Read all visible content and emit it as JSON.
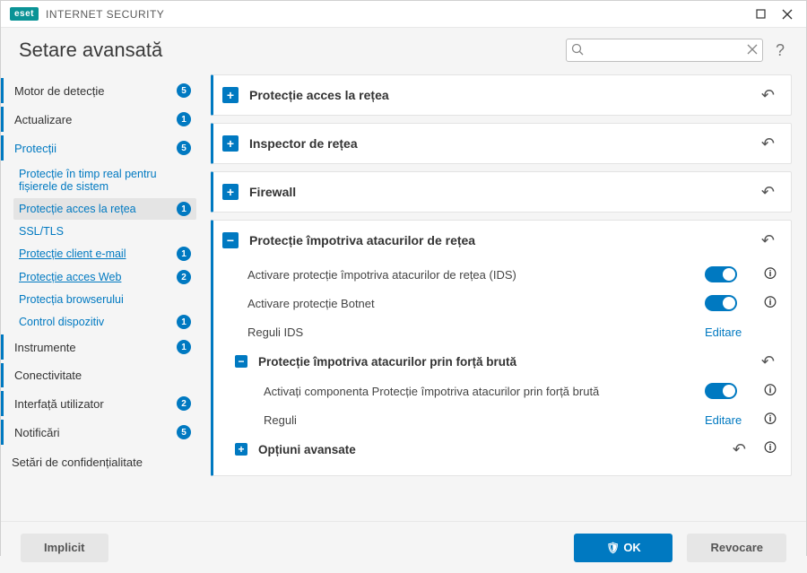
{
  "window": {
    "brand_badge": "eset",
    "brand_text": "INTERNET SECURITY"
  },
  "header": {
    "title": "Setare avansată",
    "search_placeholder": ""
  },
  "sidebar": {
    "items": [
      {
        "label": "Motor de detecție",
        "badge": "5",
        "kind": "top"
      },
      {
        "label": "Actualizare",
        "badge": "1",
        "kind": "top"
      },
      {
        "label": "Protecții",
        "badge": "5",
        "kind": "top",
        "accent": true
      },
      {
        "label": "Protecție în timp real pentru fișierele de sistem",
        "kind": "sub"
      },
      {
        "label": "Protecție acces la rețea",
        "badge": "1",
        "kind": "sub",
        "selected": true
      },
      {
        "label": "SSL/TLS",
        "kind": "sub"
      },
      {
        "label": "Protecție client e-mail",
        "badge": "1",
        "kind": "sub",
        "under": true
      },
      {
        "label": "Protecție acces Web",
        "badge": "2",
        "kind": "sub",
        "under": true
      },
      {
        "label": "Protecția browserului",
        "kind": "sub"
      },
      {
        "label": "Control dispozitiv",
        "badge": "1",
        "kind": "sub"
      },
      {
        "label": "Instrumente",
        "badge": "1",
        "kind": "top"
      },
      {
        "label": "Conectivitate",
        "kind": "top"
      },
      {
        "label": "Interfață utilizator",
        "badge": "2",
        "kind": "top"
      },
      {
        "label": "Notificări",
        "badge": "5",
        "kind": "top"
      },
      {
        "label": "Setări de confidențialitate",
        "kind": "plain"
      }
    ]
  },
  "panels": {
    "collapsed": [
      {
        "title": "Protecție acces la rețea"
      },
      {
        "title": "Inspector de rețea"
      },
      {
        "title": "Firewall"
      }
    ],
    "expanded": {
      "title": "Protecție împotriva atacurilor de rețea",
      "rows": [
        {
          "label": "Activare protecție împotriva atacurilor de rețea (IDS)",
          "type": "toggle"
        },
        {
          "label": "Activare protecție Botnet",
          "type": "toggle"
        },
        {
          "label": "Reguli IDS",
          "type": "link",
          "action": "Editare"
        }
      ],
      "sub": {
        "title": "Protecție împotriva atacurilor prin forță brută",
        "rows": [
          {
            "label": "Activați componenta Protecție împotriva atacurilor prin forță brută",
            "type": "toggle"
          },
          {
            "label": "Reguli",
            "type": "link",
            "action": "Editare"
          }
        ]
      },
      "sub2": {
        "title": "Opțiuni avansate"
      }
    }
  },
  "footer": {
    "default_btn": "Implicit",
    "ok_btn": "OK",
    "cancel_btn": "Revocare"
  }
}
